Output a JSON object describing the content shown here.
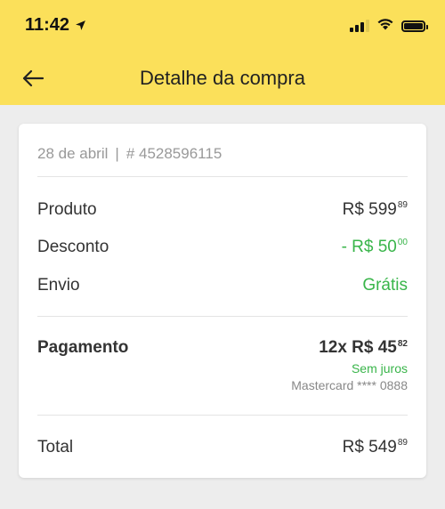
{
  "status_bar": {
    "time": "11:42"
  },
  "header": {
    "title": "Detalhe da compra"
  },
  "order": {
    "date": "28 de abril",
    "separator": "|",
    "number": "# 4528596115"
  },
  "summary": {
    "produto": {
      "label": "Produto",
      "price_main": "R$ 599",
      "price_cents": "89"
    },
    "desconto": {
      "label": "Desconto",
      "price_main": "- R$ 50",
      "price_cents": "00"
    },
    "envio": {
      "label": "Envio",
      "value": "Grátis"
    }
  },
  "payment": {
    "label": "Pagamento",
    "amount_main": "12x R$ 45",
    "amount_cents": "82",
    "installment_note": "Sem juros",
    "card_info": "Mastercard **** 0888"
  },
  "total": {
    "label": "Total",
    "price_main": "R$ 549",
    "price_cents": "89"
  },
  "colors": {
    "header_bg": "#fbe05a",
    "accent_green": "#39b54a",
    "background": "#ededed"
  }
}
